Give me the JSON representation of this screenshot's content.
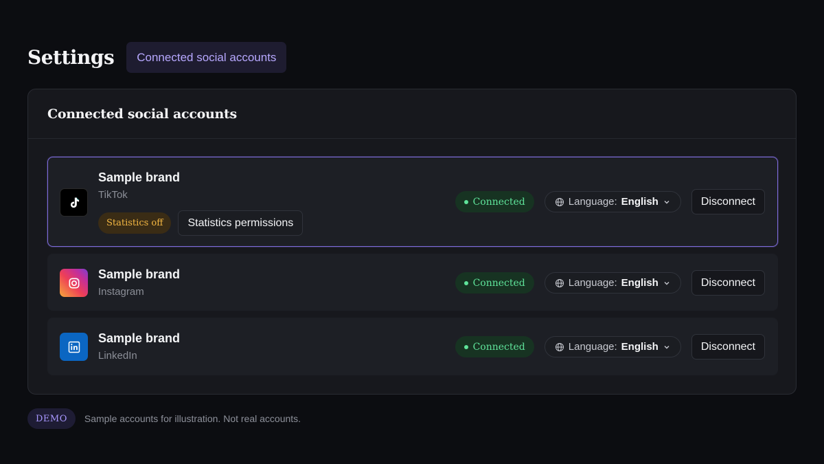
{
  "header": {
    "title": "Settings",
    "tab_label": "Connected social accounts"
  },
  "panel": {
    "title": "Connected social accounts"
  },
  "accounts": [
    {
      "brand": "Sample brand",
      "network": "TikTok",
      "icon": "tiktok-icon",
      "status": "Connected",
      "language_label": "Language:",
      "language_value": "English",
      "disconnect_label": "Disconnect",
      "statistics_badge": "Statistics off",
      "statistics_button": "Statistics permissions",
      "selected": true
    },
    {
      "brand": "Sample brand",
      "network": "Instagram",
      "icon": "instagram-icon",
      "status": "Connected",
      "language_label": "Language:",
      "language_value": "English",
      "disconnect_label": "Disconnect"
    },
    {
      "brand": "Sample brand",
      "network": "LinkedIn",
      "icon": "linkedin-icon",
      "status": "Connected",
      "language_label": "Language:",
      "language_value": "English",
      "disconnect_label": "Disconnect"
    }
  ],
  "footer": {
    "badge": "DEMO",
    "note": "Sample accounts for illustration. Not real accounts."
  },
  "colors": {
    "background": "#0c0d11",
    "panel": "#17181d",
    "accent": "#7d6ad8",
    "connected": "#5fe39a",
    "warning": "#f5b843"
  }
}
